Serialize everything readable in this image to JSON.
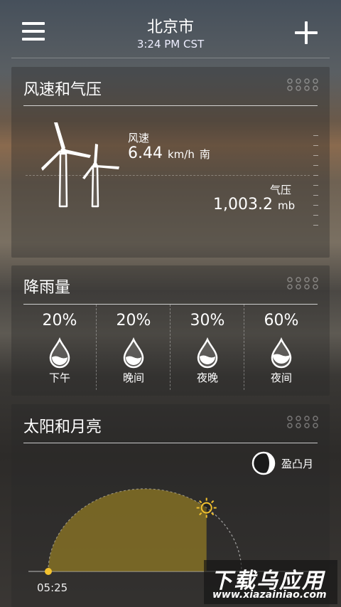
{
  "header": {
    "city": "北京市",
    "time": "3:24 PM CST"
  },
  "wind_pressure": {
    "title": "风速和气压",
    "wind_label": "风速",
    "wind_speed": "6.44",
    "wind_unit": "km/h",
    "wind_direction": "南",
    "pressure_label": "气压",
    "pressure_value": "1,003.2",
    "pressure_unit": "mb"
  },
  "precipitation": {
    "title": "降雨量",
    "items": [
      {
        "percent": "20%",
        "label": "下午",
        "level": 0.2
      },
      {
        "percent": "20%",
        "label": "晚间",
        "level": 0.2
      },
      {
        "percent": "30%",
        "label": "夜晚",
        "level": 0.3
      },
      {
        "percent": "60%",
        "label": "夜间",
        "level": 0.6
      }
    ]
  },
  "sun_moon": {
    "title": "太阳和月亮",
    "moon_phase": "盈凸月",
    "sunrise": "05:25",
    "day_progress": 0.72,
    "sun_color": "#f2c12e"
  },
  "watermark": {
    "cn": "下载乌应用",
    "en": "www.xiazainiao.com"
  }
}
